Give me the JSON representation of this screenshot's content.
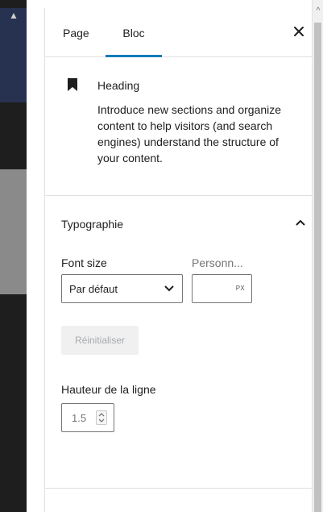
{
  "tabs": [
    {
      "label": "Page"
    },
    {
      "label": "Bloc"
    }
  ],
  "block": {
    "title": "Heading",
    "description": "Introduce new sections and organize content to help visitors (and search engines) understand the structure of your content.",
    "icon": "bookmark-icon"
  },
  "typography": {
    "title": "Typographie",
    "font_size_label": "Font size",
    "custom_label": "Personn...",
    "font_size_selected": "Par défaut",
    "unit": "PX",
    "reset_label": "Réinitialiser",
    "line_height_label": "Hauteur de la ligne",
    "line_height_value": "1.5"
  },
  "colors": {
    "accent": "#007cba",
    "border": "#e0e0e0",
    "text": "#1e1e1e"
  }
}
